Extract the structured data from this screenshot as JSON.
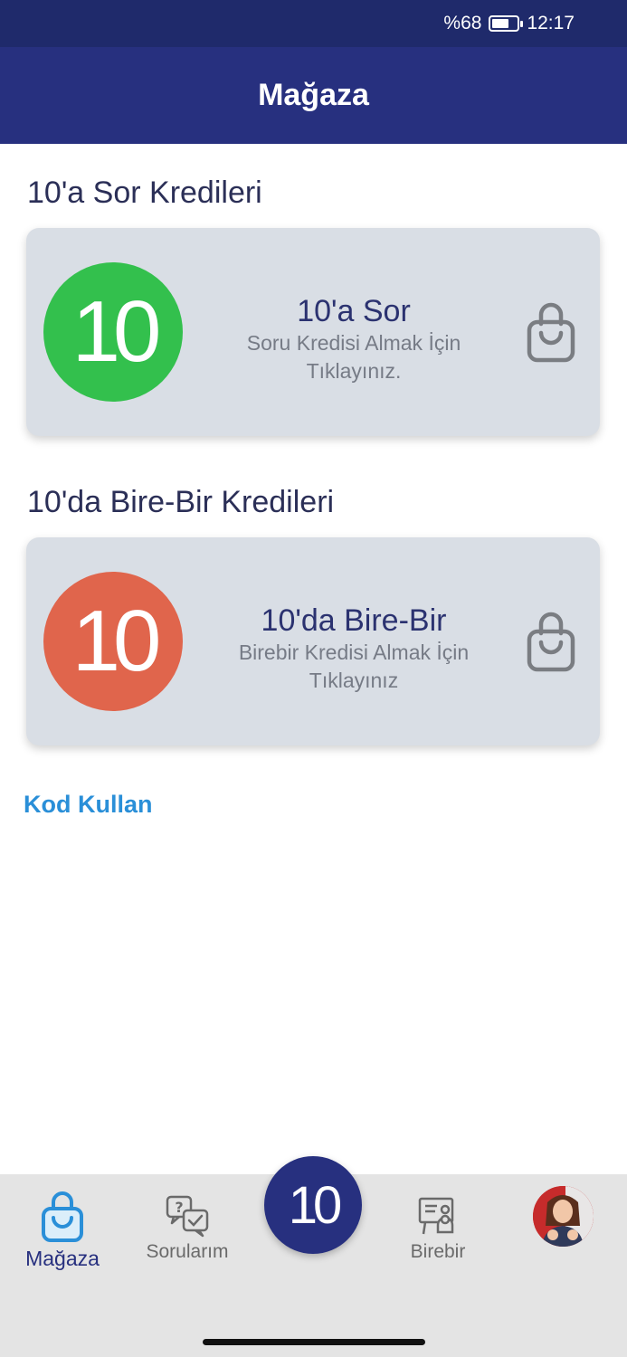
{
  "status_bar": {
    "battery_text": "%68",
    "battery_level": 0.68,
    "time": "12:17"
  },
  "app_bar": {
    "title": "Mağaza"
  },
  "sections": [
    {
      "title": "10'a Sor Kredileri",
      "card": {
        "logo_text": "10",
        "logo_color": "#33c04d",
        "title": "10'a Sor",
        "subtitle": "Soru Kredisi Almak İçin Tıklayınız.",
        "icon": "shopping-bag-icon"
      }
    },
    {
      "title": "10'da Bire-Bir Kredileri",
      "card": {
        "logo_text": "10",
        "logo_color": "#e0654c",
        "title": "10'da Bire-Bir",
        "subtitle": "Birebir Kredisi Almak İçin Tıklayınız",
        "icon": "shopping-bag-icon"
      }
    }
  ],
  "kod_link": "Kod Kullan",
  "bottom_nav": {
    "items": [
      {
        "label": "Mağaza",
        "icon": "shopping-bag-icon",
        "active": true
      },
      {
        "label": "Sorularım",
        "icon": "question-chat-icon",
        "active": false
      },
      {
        "label": "Birebir",
        "icon": "whiteboard-teacher-icon",
        "active": false
      }
    ],
    "center_text": "10",
    "accent_color": "#27307f"
  }
}
